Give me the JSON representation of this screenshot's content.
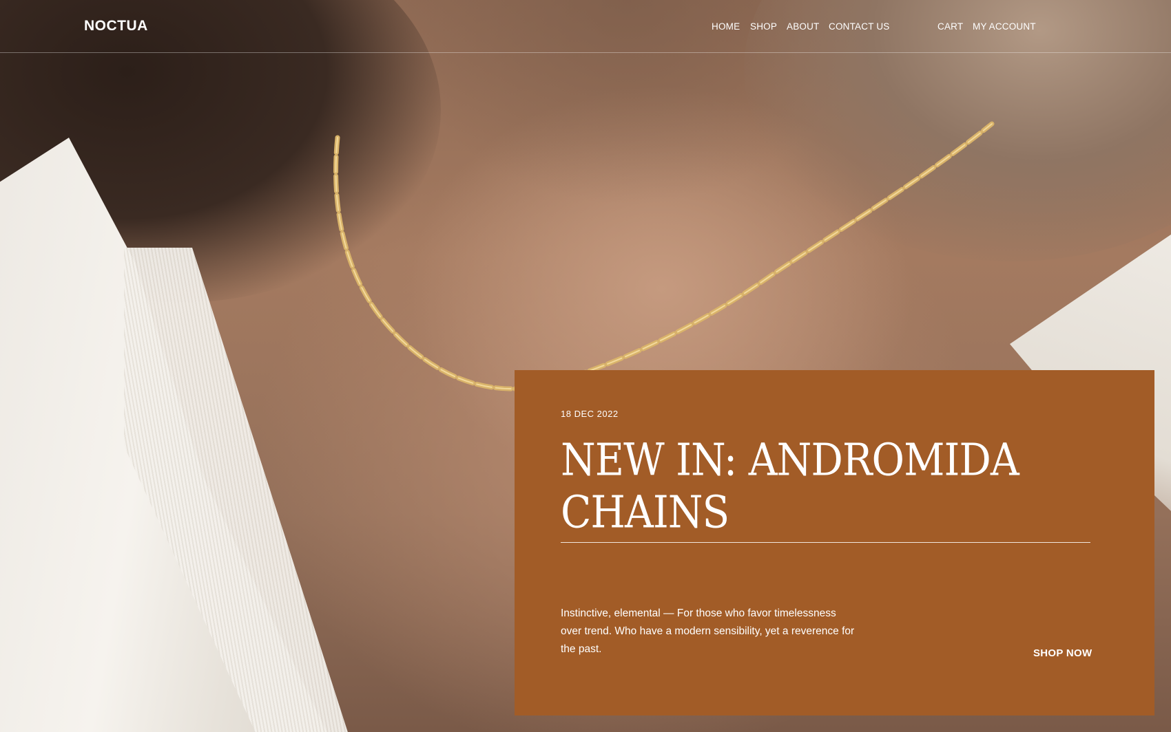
{
  "brand": {
    "logo": "NOCTUA"
  },
  "nav": {
    "items": [
      {
        "label": "HOME"
      },
      {
        "label": "SHOP"
      },
      {
        "label": "ABOUT"
      },
      {
        "label": "CONTACT US"
      }
    ],
    "cart": "CART",
    "account": "MY ACCOUNT"
  },
  "feature": {
    "date": "18 DEC 2022",
    "title": "NEW IN: ANDROMIDA CHAINS",
    "description": "Instinctive, elemental — For those who favor timelessness over trend. Who have a modern sensibility, yet a reverence for the past.",
    "cta": "SHOP NOW"
  },
  "colors": {
    "card_background": "#a25c27",
    "text": "#ffffff"
  }
}
